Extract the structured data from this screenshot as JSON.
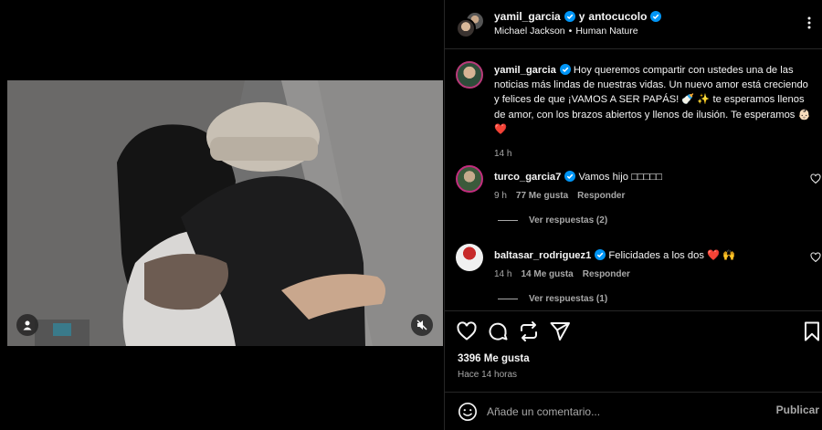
{
  "colors": {
    "background": "#000000",
    "verified": "#0095f6",
    "heart": "#ff3040",
    "muted_text": "#a8a8a8",
    "border": "#262626"
  },
  "media": {
    "user_tag_icon": "user-icon",
    "mute_icon": "speaker-muted-icon"
  },
  "header": {
    "user1": "yamil_garcia",
    "separator": "y",
    "user2": "antocucolo",
    "audio_artist": "Michael Jackson",
    "audio_dot": "•",
    "audio_track": "Human Nature",
    "more_icon": "more-vertical-icon"
  },
  "caption": {
    "username": "yamil_garcia",
    "text": " Hoy queremos compartir con ustedes una de las noticias más lindas de nuestras vidas. Un nuevo amor está creciendo y felices de que ¡VAMOS A SER PAPÁS! 🍼 ✨ te esperamos llenos de amor, con los brazos abiertos y llenos de ilusión. Te esperamos 👶🏻 ❤️",
    "time": "14 h"
  },
  "comments": [
    {
      "username": "turco_garcia7",
      "text": " Vamos hijo □□□□□",
      "time": "9 h",
      "likes": "77 Me gusta",
      "reply": "Responder",
      "view_replies": "Ver respuestas (2)"
    },
    {
      "username": "baltasar_rodriguez1",
      "text": " Felicidades a los dos ❤️ 🙌",
      "time": "14 h",
      "likes": "14 Me gusta",
      "reply": "Responder",
      "view_replies": "Ver respuestas (1)"
    }
  ],
  "actions": {
    "like_icon": "heart-icon",
    "comment_icon": "comment-icon",
    "repost_icon": "repost-icon",
    "share_icon": "share-icon",
    "save_icon": "bookmark-icon",
    "likes_count": "3396 Me gusta",
    "posted_time": "Hace 14 horas"
  },
  "comment_box": {
    "placeholder": "Añade un comentario...",
    "publish_label": "Publicar",
    "emoji_icon": "emoji-icon"
  }
}
